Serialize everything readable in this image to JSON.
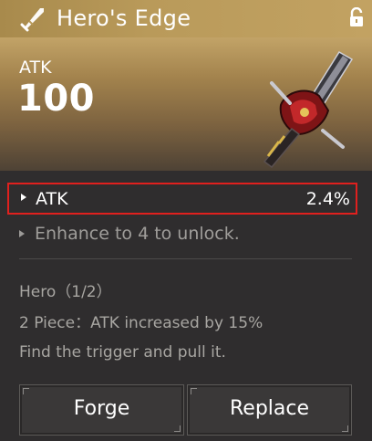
{
  "header": {
    "title": "Hero's Edge",
    "weapon_type_icon": "sword-slash-icon",
    "lock_icon": "unlocked-padlock-icon"
  },
  "main_stat": {
    "label": "ATK",
    "value": "100"
  },
  "sub_stat": {
    "name": "ATK",
    "value": "2.4%",
    "highlight_color": "#e0201e"
  },
  "locked_stat": {
    "text": "Enhance to 4 to unlock."
  },
  "set_info": {
    "name": "Hero（1/2）",
    "bonus": "2 Piece：ATK increased by 15%",
    "flavor": "Find the trigger and pull it."
  },
  "buttons": {
    "forge": "Forge",
    "replace": "Replace"
  },
  "colors": {
    "header_gold": "#b99a5a",
    "panel_bg": "#2f2d2e",
    "muted_text": "#a8a6a2"
  }
}
